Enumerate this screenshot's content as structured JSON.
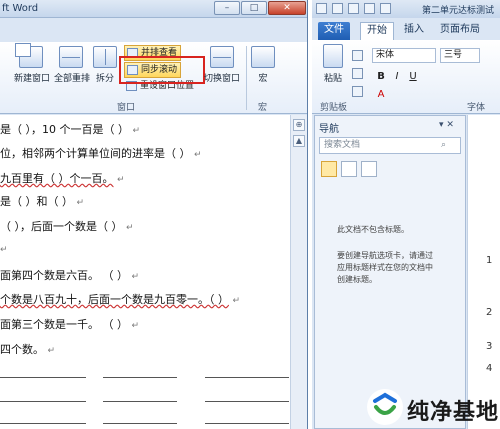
{
  "left_window": {
    "title": "ft Word",
    "title_buttons": {
      "minimize": "–",
      "maximize": "□",
      "close": "✕"
    },
    "ribbon": {
      "buttons": {
        "new_window": "新建窗口",
        "arrange_all": "全部重排",
        "split": "拆分",
        "side_by_side": "并排查看",
        "sync_scroll": "同步滚动",
        "reset_position": "重设窗口位置",
        "switch_window": "切换窗口",
        "macros": "宏"
      },
      "group_labels": {
        "window": "窗口",
        "macro": "宏"
      }
    },
    "document_lines": [
      {
        "text": "是（      ），10 个一百是（          ）",
        "mark": "↵"
      },
      {
        "text": "位，相邻两个计算单位间的进率是（             ）",
        "mark": "↵"
      },
      {
        "text": "九百里有（      ）个一百。",
        "mark": "↵"
      },
      {
        "text": "是（      ）和（      ）",
        "mark": "↵"
      },
      {
        "text": "（      ），后面一个数是（          ）",
        "mark": "↵"
      },
      {
        "text": "",
        "mark": "↵"
      },
      {
        "text": "面第四个数是六百。      （      ）",
        "mark": "↵"
      },
      {
        "text": "个数是八百九十，后面一个数是九百零一。（      ）",
        "mark": "↵"
      },
      {
        "text": "面第三个数是一千。                  （      ）",
        "mark": "↵"
      },
      {
        "text": "四个数。",
        "mark": "↵"
      }
    ],
    "scroll": {
      "up": "▲",
      "collapse": "⊕"
    }
  },
  "right_window": {
    "title": "第二单元达标测试",
    "tabs": [
      "文件",
      "开始",
      "插入",
      "页面布局"
    ],
    "active_tab": "开始",
    "font_name": "宋体",
    "font_size": "三号",
    "paste_label": "粘贴",
    "clipboard_label": "剪贴板",
    "font_group_label": "字体",
    "format_buttons": {
      "bold": "B",
      "italic": "I",
      "underline": "U",
      "font_color": "A"
    },
    "nav_pane": {
      "title": "导航",
      "controls": "▾ ✕",
      "search_placeholder": "搜索文档",
      "search_icon_glyph": "⌕",
      "no_headings": "此文档不包含标题。",
      "instructions": [
        "要创建导航选项卡，请通过",
        "应用标题样式在您的文档中",
        "创建标题。"
      ]
    },
    "doc_chars": [
      "1",
      "2",
      "3",
      "4"
    ]
  },
  "watermark": {
    "text": "纯净基地",
    "colors": {
      "blue": "#1e6fd9",
      "green": "#3aa346"
    }
  },
  "colors": {
    "highlight_box": "#d8241f",
    "file_tab": "#2a6cc4"
  }
}
